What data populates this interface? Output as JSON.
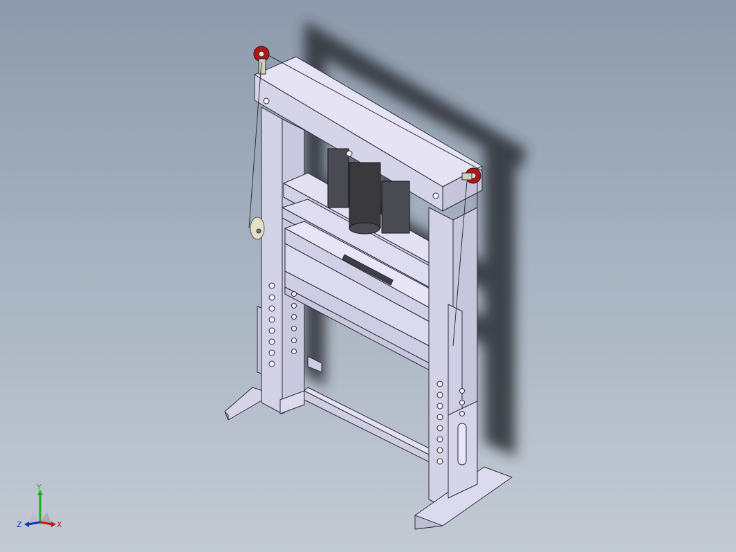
{
  "viewport": {
    "background_top": "#8c9aab",
    "background_bottom": "#c3cad4"
  },
  "model": {
    "description_icon": "hydraulic-press-frame-icon",
    "part_color": "#d8d6ea",
    "edge_color": "#2a2a3a",
    "pulley_color": "#b01818",
    "cylinder_color": "#3a3a3e"
  },
  "triad": {
    "x_label": "X",
    "y_label": "Y",
    "z_label": "Z",
    "x_color": "#d01010",
    "y_color": "#18b018",
    "z_color": "#1030d0"
  }
}
